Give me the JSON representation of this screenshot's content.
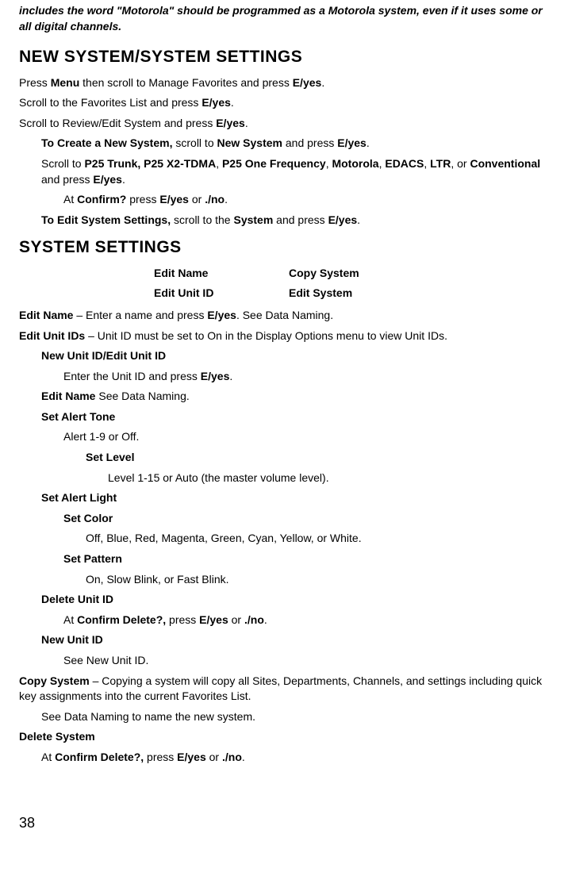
{
  "intro": "includes the word \"Motorola\" should be programmed as a Motorola system, even if it uses some or all digital channels.",
  "heading1": "NEW SYSTEM/SYSTEM SETTINGS",
  "p1_a": "Press ",
  "p1_b": "Menu",
  "p1_c": " then scroll to Manage Favorites and press ",
  "p1_d": "E/yes",
  "p1_e": ".",
  "p2_a": "Scroll to the Favorites List and press ",
  "p2_b": "E/yes",
  "p2_c": ".",
  "p3_a": "Scroll to Review/Edit System and press ",
  "p3_b": "E/yes",
  "p3_c": ".",
  "p4_a": "To Create a New System,",
  "p4_b": " scroll to ",
  "p4_c": "New System",
  "p4_d": " and press ",
  "p4_e": "E/yes",
  "p4_f": ".",
  "p5_a": "Scroll to ",
  "p5_b": "P25 Trunk, P25 X2-TDMA",
  "p5_c": ", ",
  "p5_d": "P25 One Frequency",
  "p5_e": ", ",
  "p5_f": "Motorola",
  "p5_g": ", ",
  "p5_h": "EDACS",
  "p5_i": ", ",
  "p5_j": "LTR",
  "p5_k": ", or ",
  "p5_l": "Conventional",
  "p5_m": " and press ",
  "p5_n": "E/yes",
  "p5_o": ".",
  "p6_a": "At ",
  "p6_b": "Confirm?",
  "p6_c": " press ",
  "p6_d": "E/yes",
  "p6_e": " or ",
  "p6_f": "./no",
  "p6_g": ".",
  "p7_a": "To Edit System Settings,",
  "p7_b": " scroll to the ",
  "p7_c": "System",
  "p7_d": " and press ",
  "p7_e": "E/yes",
  "p7_f": ".",
  "heading2": "SYSTEM SETTINGS",
  "table": {
    "r1c1": "Edit Name",
    "r1c2": "Copy System",
    "r2c1": "Edit Unit ID",
    "r2c2": "Edit System"
  },
  "p8_a": "Edit Name",
  "p8_b": " – Enter a name and press ",
  "p8_c": "E/yes",
  "p8_d": ". See Data Naming.",
  "p9_a": "Edit Unit IDs",
  "p9_b": " – Unit ID must be set to On in the Display Options menu to view Unit IDs.",
  "p10": "New Unit ID/Edit Unit ID",
  "p11_a": "Enter the Unit ID and press ",
  "p11_b": "E/yes",
  "p11_c": ".",
  "p12_a": "Edit Name",
  "p12_b": " See Data Naming.",
  "p13": "Set Alert Tone",
  "p14": "Alert 1-9 or Off.",
  "p15": "Set Level",
  "p16": "Level 1-15 or Auto (the master volume level).",
  "p17": "Set Alert Light",
  "p18": "Set Color",
  "p19": "Off, Blue, Red, Magenta, Green, Cyan, Yellow, or White.",
  "p20": "Set Pattern",
  "p21": "On, Slow Blink, or Fast Blink.",
  "p22": "Delete Unit ID",
  "p23_a": "At ",
  "p23_b": "Confirm Delete?,",
  "p23_c": " press ",
  "p23_d": "E/yes",
  "p23_e": " or ",
  "p23_f": "./no",
  "p23_g": ".",
  "p24": "New Unit ID",
  "p25": "See New Unit ID.",
  "p26_a": "Copy System",
  "p26_b": " – Copying a system will copy all Sites, Departments, Channels, and settings including quick key assignments into the current Favorites List.",
  "p27": "See Data Naming to name the new system.",
  "p28": "Delete System",
  "p29_a": "At ",
  "p29_b": "Confirm Delete?,",
  "p29_c": " press ",
  "p29_d": "E/yes",
  "p29_e": " or ",
  "p29_f": "./no",
  "p29_g": ".",
  "pageNumber": "38"
}
